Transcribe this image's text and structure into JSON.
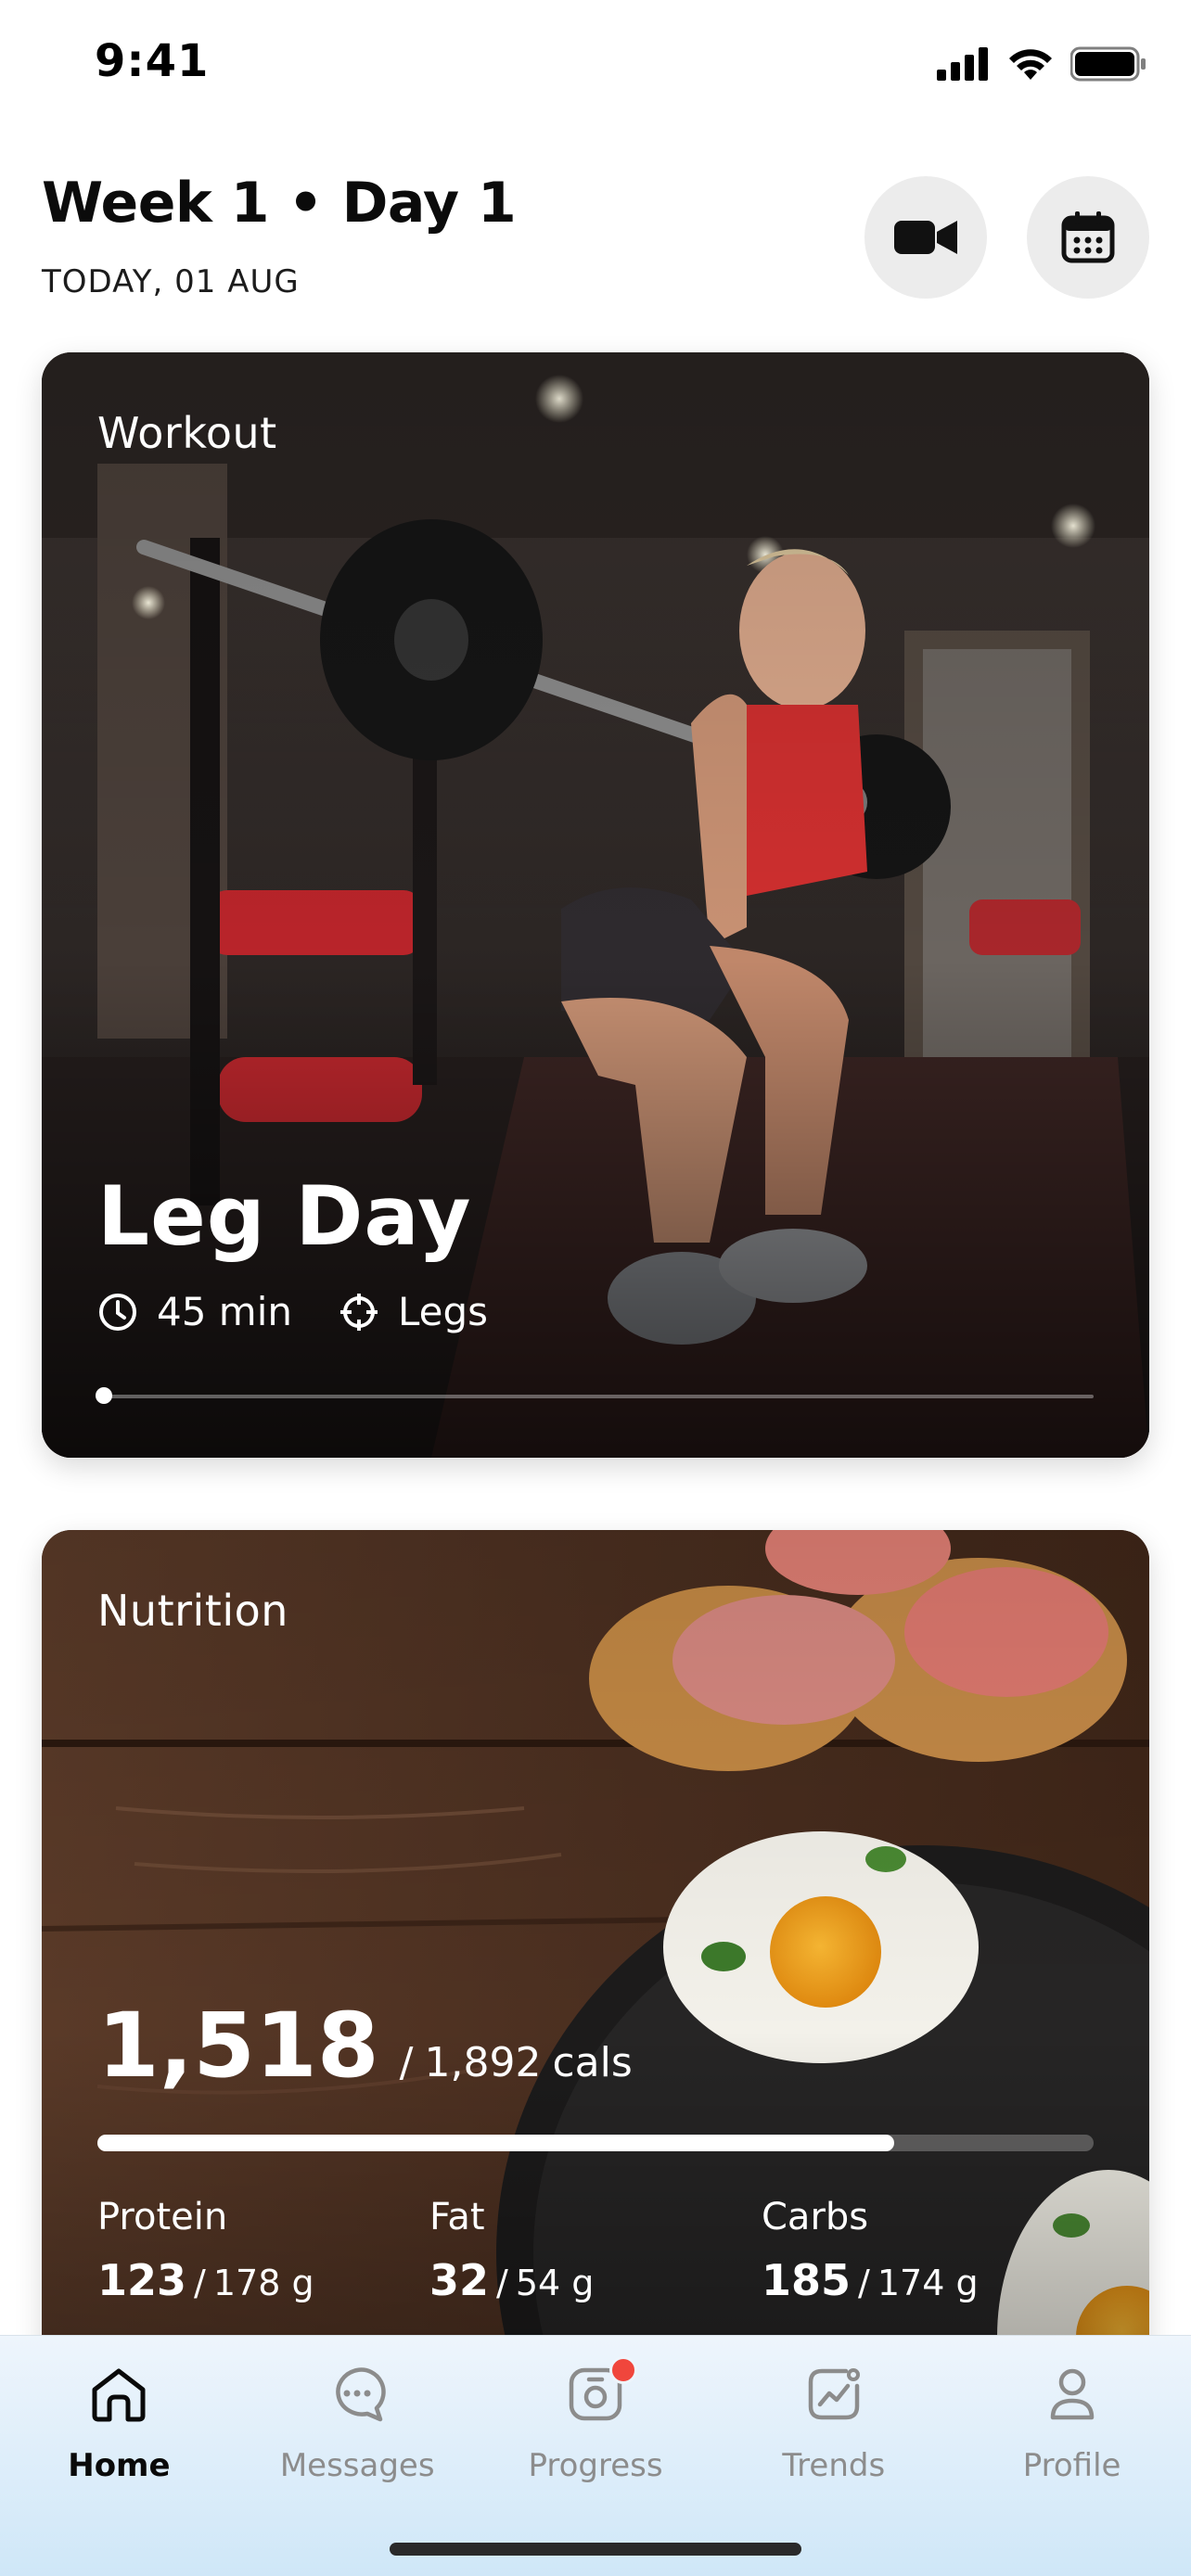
{
  "status_bar": {
    "time": "9:41"
  },
  "header": {
    "title": "Week 1 • Day 1",
    "subtitle": "TODAY, 01 AUG"
  },
  "workout": {
    "label": "Workout",
    "title": "Leg Day",
    "duration": "45 min",
    "focus": "Legs",
    "progress_fraction": 0.0
  },
  "nutrition": {
    "label": "Nutrition",
    "calories_current": "1,518",
    "calories_goal": "1,892",
    "calories_unit": "cals",
    "calories_fraction": 0.8,
    "macros": [
      {
        "label": "Protein",
        "current": "123",
        "goal": "178 g"
      },
      {
        "label": "Fat",
        "current": "32",
        "goal": "54 g"
      },
      {
        "label": "Carbs",
        "current": "185",
        "goal": "174 g"
      }
    ]
  },
  "tab_bar": {
    "tabs": [
      {
        "label": "Home",
        "icon": "home-icon",
        "active": true
      },
      {
        "label": "Messages",
        "icon": "chat-icon",
        "active": false
      },
      {
        "label": "Progress",
        "icon": "camera-icon",
        "active": false,
        "badge": true
      },
      {
        "label": "Trends",
        "icon": "trend-chart-icon",
        "active": false
      },
      {
        "label": "Profile",
        "icon": "user-icon",
        "active": false
      }
    ]
  },
  "colors": {
    "accent_badge": "#f0463c",
    "tab_inactive": "#8c8c8c",
    "tab_active": "#0a0a0a"
  }
}
